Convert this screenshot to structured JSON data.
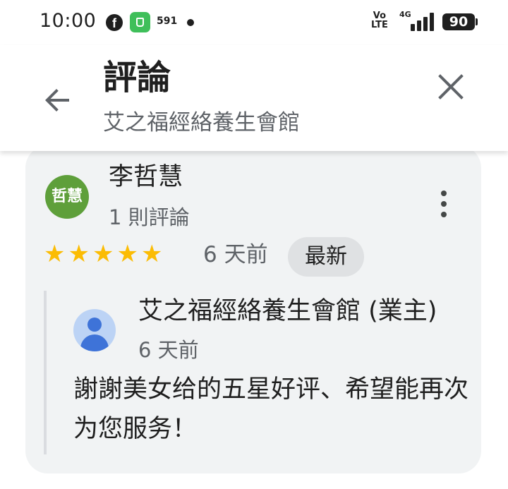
{
  "status_bar": {
    "time": "10:00",
    "notification_count": "591",
    "volte": "Vo\nLTE",
    "network": "4G",
    "battery": "90"
  },
  "header": {
    "title": "評論",
    "subtitle": "艾之福經絡養生會館"
  },
  "review": {
    "avatar_text": "哲慧",
    "avatar_color": "#5e9f3a",
    "reviewer_name": "李哲慧",
    "review_count": "1 則評論",
    "rating": 5,
    "stars": [
      "★",
      "★",
      "★",
      "★",
      "★"
    ],
    "time": "6 天前",
    "badge": "最新",
    "reply": {
      "owner_name": "艾之福經絡養生會館 (業主)",
      "time": "6 天前",
      "text": "謝謝美女给的五星好评、希望能再次为您服务！"
    }
  },
  "icons": {
    "back": "arrow-back-icon",
    "close": "close-icon",
    "more": "more-vert-icon",
    "star_color": "#fbbc04"
  }
}
